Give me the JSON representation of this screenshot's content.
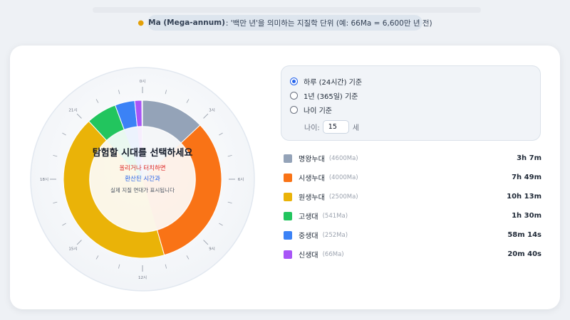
{
  "info": {
    "icon": "lightbulb-icon",
    "term": "Ma (Mega-annum)",
    "desc": ": '백만 년'을 의미하는 지질학 단위 (예: 66Ma = 6,600만 년 전)"
  },
  "dial": {
    "hour_labels": [
      "0시",
      "3시",
      "6시",
      "9시",
      "12시",
      "15시",
      "18시",
      "21시"
    ],
    "center": {
      "title": "탐험할 시대를 선택하세요",
      "line_red": "올리거나 터치하면",
      "line_blue": "환산된 시간과",
      "line_grey": "실제 지질 연대가 표시됩니다"
    }
  },
  "options": {
    "items": [
      {
        "label": "하루 (24시간) 기준",
        "selected": true
      },
      {
        "label": "1년 (365일) 기준",
        "selected": false
      },
      {
        "label": "나이 기준",
        "selected": false
      }
    ],
    "age_label": "나이:",
    "age_value": "15",
    "age_unit": "세"
  },
  "eras": [
    {
      "name": "명왕누대",
      "ma": "(4600Ma)",
      "duration": "3h 7m",
      "color": "#94a3b8"
    },
    {
      "name": "시생누대",
      "ma": "(4000Ma)",
      "duration": "7h 49m",
      "color": "#f97316"
    },
    {
      "name": "원생누대",
      "ma": "(2500Ma)",
      "duration": "10h 13m",
      "color": "#eab308"
    },
    {
      "name": "고생대",
      "ma": "(541Ma)",
      "duration": "1h 30m",
      "color": "#22c55e"
    },
    {
      "name": "중생대",
      "ma": "(252Ma)",
      "duration": "58m 14s",
      "color": "#3b82f6"
    },
    {
      "name": "신생대",
      "ma": "(66Ma)",
      "duration": "20m 40s",
      "color": "#a855f7"
    }
  ]
}
